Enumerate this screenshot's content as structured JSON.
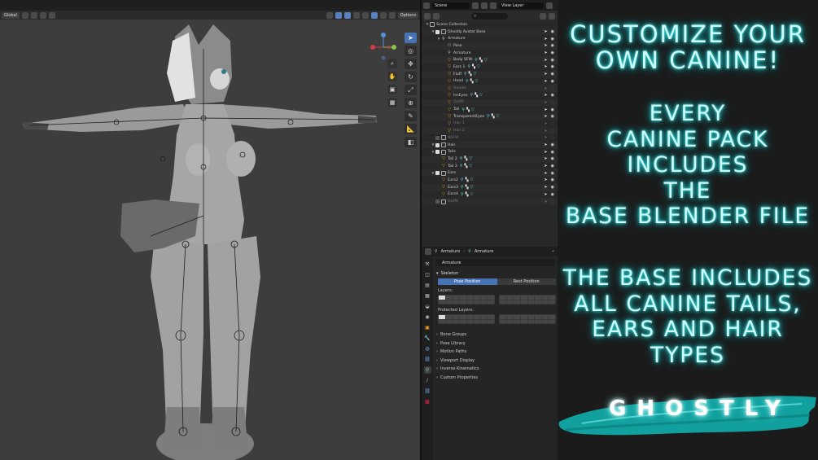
{
  "viewport": {
    "transform_orientation": "Global",
    "options_label": "Options"
  },
  "outliner": {
    "scene": "Scene",
    "view_layer": "View Layer",
    "rows": [
      {
        "label": "Scene Collection",
        "icon": "collection",
        "depth": 0,
        "dim": false
      },
      {
        "label": "Ghostly Avatar Base",
        "icon": "collection",
        "depth": 1,
        "dim": false,
        "check": true
      },
      {
        "label": "Armature",
        "icon": "armature",
        "depth": 2,
        "dim": false
      },
      {
        "label": "Pose",
        "icon": "pose",
        "depth": 3,
        "dim": false
      },
      {
        "label": "Armature",
        "icon": "armature-data",
        "depth": 3,
        "dim": false
      },
      {
        "label": "Body SFW",
        "icon": "mesh",
        "depth": 3,
        "dim": false
      },
      {
        "label": "Ears 1",
        "icon": "mesh",
        "depth": 3,
        "dim": false
      },
      {
        "label": "Fluff",
        "icon": "mesh",
        "depth": 3,
        "dim": false
      },
      {
        "label": "Head",
        "icon": "mesh",
        "depth": 3,
        "dim": false
      },
      {
        "label": "Hoodie",
        "icon": "mesh",
        "depth": 3,
        "dim": true
      },
      {
        "label": "InsEyes",
        "icon": "mesh",
        "depth": 3,
        "dim": false
      },
      {
        "label": "Outfit",
        "icon": "mesh",
        "depth": 3,
        "dim": true
      },
      {
        "label": "Tail",
        "icon": "mesh",
        "depth": 3,
        "dim": false
      },
      {
        "label": "TransparentEyes",
        "icon": "mesh",
        "depth": 3,
        "dim": false
      },
      {
        "label": "Hair 1",
        "icon": "mesh",
        "depth": 3,
        "dim": true
      },
      {
        "label": "Hair 2",
        "icon": "mesh",
        "depth": 3,
        "dim": true
      },
      {
        "label": "NSFW",
        "icon": "collection",
        "depth": 1,
        "dim": true,
        "check": false
      },
      {
        "label": "Hair",
        "icon": "collection",
        "depth": 1,
        "dim": false,
        "check": true
      },
      {
        "label": "Tails",
        "icon": "collection",
        "depth": 1,
        "dim": false,
        "check": true
      },
      {
        "label": "Tail 2",
        "icon": "mesh",
        "depth": 2,
        "dim": false
      },
      {
        "label": "Tail 3",
        "icon": "mesh",
        "depth": 2,
        "dim": false
      },
      {
        "label": "Ears",
        "icon": "collection",
        "depth": 1,
        "dim": false,
        "check": true
      },
      {
        "label": "Ears2",
        "icon": "mesh",
        "depth": 2,
        "dim": false
      },
      {
        "label": "Ears3",
        "icon": "mesh",
        "depth": 2,
        "dim": false
      },
      {
        "label": "Ears4",
        "icon": "mesh",
        "depth": 2,
        "dim": false
      },
      {
        "label": "Outfit",
        "icon": "collection",
        "depth": 1,
        "dim": true,
        "check": false
      }
    ]
  },
  "properties": {
    "breadcrumb_object": "Armature",
    "breadcrumb_data": "Armature",
    "data_name": "Armature",
    "skeleton_section": "Skeleton",
    "pose_position": "Pose Position",
    "rest_position": "Rest Position",
    "layers_label": "Layers:",
    "protected_layers_label": "Protected Layers:",
    "panels": [
      "Bone Groups",
      "Pose Library",
      "Motion Paths",
      "Viewport Display",
      "Inverse Kinematics",
      "Custom Properties"
    ]
  },
  "ad": {
    "headline": [
      "CUSTOMIZE YOUR",
      "OWN CANINE!"
    ],
    "pack_line": [
      "EVERY",
      "CANINE PACK",
      "INCLUDES",
      "THE",
      "BASE BLENDER FILE"
    ],
    "base_line": [
      "THE BASE INCLUDES",
      "ALL CANINE TAILS,",
      "EARS AND HAIR",
      "TYPES"
    ],
    "brand": "GHOSTLY",
    "glow_color": "#40e8e8",
    "brush_color": "#0fb7b5"
  }
}
